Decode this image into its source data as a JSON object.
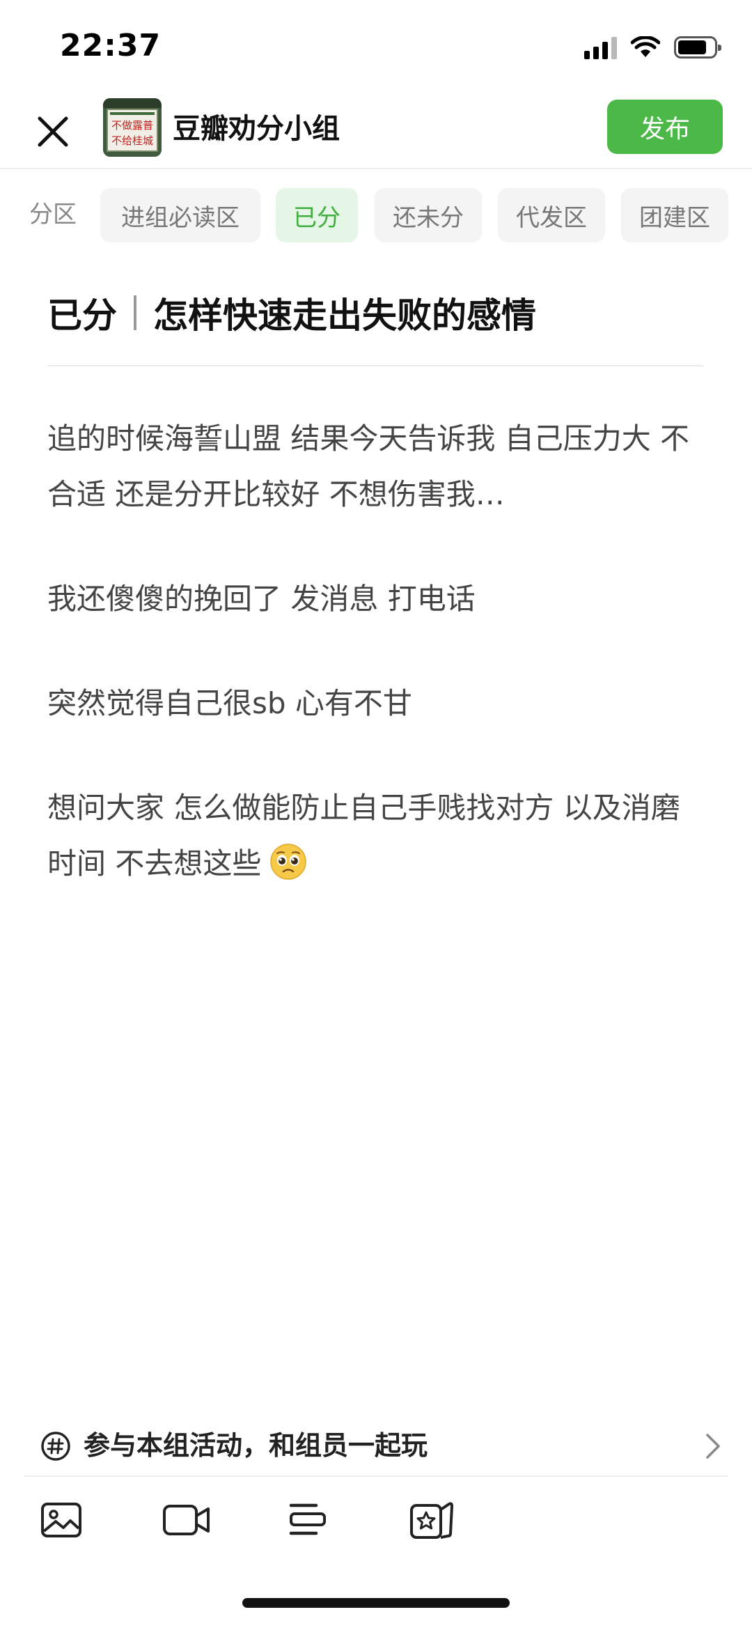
{
  "status_bar": {
    "time": "22:37"
  },
  "header": {
    "group_name": "豆瓣劝分小组",
    "publish_label": "发布",
    "avatar_text": [
      "不做露普",
      "不给桂城"
    ]
  },
  "categories": {
    "label": "分区",
    "items": [
      {
        "label": "进组必读区",
        "active": false
      },
      {
        "label": "已分",
        "active": true
      },
      {
        "label": "还未分",
        "active": false
      },
      {
        "label": "代发区",
        "active": false
      },
      {
        "label": "团建区",
        "active": false
      }
    ]
  },
  "post": {
    "tag": "已分",
    "title": "怎样快速走出失败的感情",
    "paragraphs": [
      "追的时候海誓山盟 结果今天告诉我 自己压力大 不合适 还是分开比较好 不想伤害我…",
      "我还傻傻的挽回了 发消息 打电话",
      "突然觉得自己很sb 心有不甘",
      "想问大家 怎么做能防止自己手贱找对方 以及消磨时间 不去想这些"
    ]
  },
  "activity": {
    "text": "参与本组活动，和组员一起玩"
  },
  "colors": {
    "accent": "#4cb848",
    "chip_active_bg": "#e6f6e6",
    "chip_active_text": "#3fae3f"
  }
}
